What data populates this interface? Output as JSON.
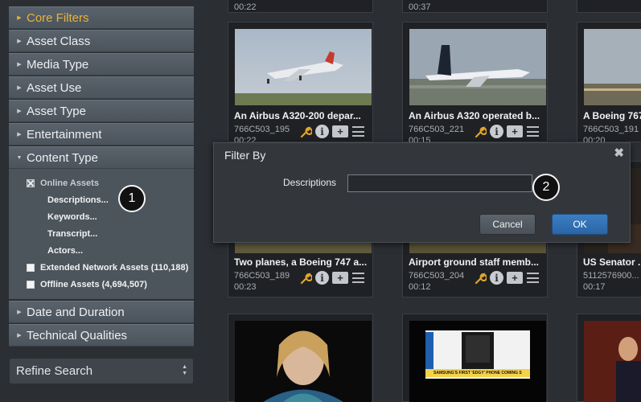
{
  "sidebar": {
    "facets": [
      {
        "label": "Core Filters"
      },
      {
        "label": "Asset Class"
      },
      {
        "label": "Media Type"
      },
      {
        "label": "Asset Use"
      },
      {
        "label": "Asset Type"
      },
      {
        "label": "Entertainment"
      },
      {
        "label": "Content Type"
      }
    ],
    "content_type": {
      "online": "Online Assets",
      "sublinks": [
        "Descriptions...",
        "Keywords...",
        "Transcript...",
        "Actors..."
      ],
      "extended": "Extended Network Assets (110,188)",
      "offline": "Offline Assets (4,694,507)"
    },
    "lower_facets": [
      {
        "label": "Date and Duration"
      },
      {
        "label": "Technical Qualities"
      }
    ],
    "refine": "Refine Search"
  },
  "top_row": [
    {
      "dur": "00:22"
    },
    {
      "dur": "00:37"
    },
    {
      "dur": ""
    }
  ],
  "cards": [
    {
      "title": "An Airbus A320-200 depar...",
      "id": "766C503_195",
      "dur": "00:22"
    },
    {
      "title": "An Airbus A320 operated b...",
      "id": "766C503_221",
      "dur": "00:15"
    },
    {
      "title": "A Boeing 767 ...",
      "id": "766C503_191",
      "dur": "00:20"
    },
    {
      "title": "Two planes, a Boeing 747 a...",
      "id": "766C503_189",
      "dur": "00:23"
    },
    {
      "title": "Airport ground staff memb...",
      "id": "766C503_204",
      "dur": "00:12"
    },
    {
      "title": "US Senator ...",
      "id": "5112576900...",
      "dur": "00:17"
    }
  ],
  "dialog": {
    "title": "Filter By",
    "field_label": "Descriptions",
    "input_value": "",
    "cancel": "Cancel",
    "ok": "OK",
    "close_glyph": "✖"
  },
  "callouts": [
    "1",
    "2"
  ],
  "thumb_text": "SAMSUNG'S FIRST 'EDGY' PHONE COMING SOON",
  "colors": {
    "accent": "#e9b23a",
    "ok_button": "#2f6fb0",
    "panel": "#4c545c"
  }
}
